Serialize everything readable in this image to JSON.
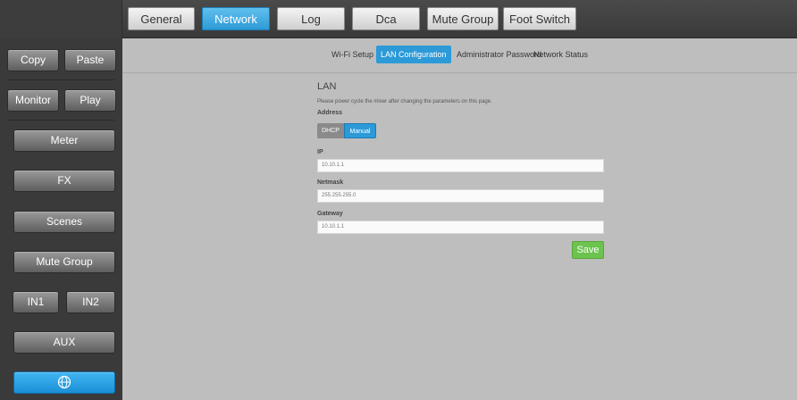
{
  "top_tabs": [
    {
      "label": "General",
      "active": false
    },
    {
      "label": "Network",
      "active": true
    },
    {
      "label": "Log",
      "active": false
    },
    {
      "label": "Dca",
      "active": false
    },
    {
      "label": "Mute Group",
      "active": false
    },
    {
      "label": "Foot Switch",
      "active": false
    }
  ],
  "sidebar": {
    "copy": "Copy",
    "paste": "Paste",
    "monitor": "Monitor",
    "play": "Play",
    "meter": "Meter",
    "fx": "FX",
    "scenes": "Scenes",
    "mute_group": "Mute Group",
    "in1": "IN1",
    "in2": "IN2",
    "aux": "AUX",
    "network_icon": "globe-icon"
  },
  "subnav": [
    {
      "label": "Wi-Fi Setup",
      "active": false
    },
    {
      "label": "LAN Configuration",
      "active": true
    },
    {
      "label": "Administrator Password",
      "active": false
    },
    {
      "label": "Network Status",
      "active": false
    }
  ],
  "lan": {
    "title": "LAN",
    "note": "Please power cycle the mixer after changing the parameters on this page.",
    "address_label": "Address",
    "dhcp_label": "DHCP",
    "manual_label": "Manual",
    "ip_label": "IP",
    "ip_value": "10.10.1.1",
    "netmask_label": "Netmask",
    "netmask_value": "255.255.255.0",
    "gateway_label": "Gateway",
    "gateway_value": "10.10.1.1",
    "save_label": "Save"
  },
  "colors": {
    "accent_blue": "#2d9ad8",
    "save_green": "#6cc34e",
    "panel_gray": "#bebebe",
    "sidebar_dark": "#3a3a3a"
  }
}
